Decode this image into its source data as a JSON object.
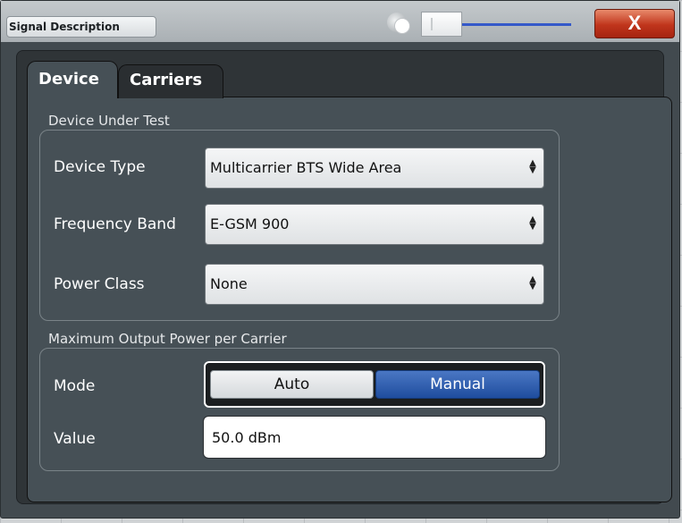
{
  "window": {
    "title": "Signal Description",
    "close_label": "X"
  },
  "tabs": [
    {
      "label": "Device",
      "active": true
    },
    {
      "label": "Carriers",
      "active": false
    }
  ],
  "device_under_test": {
    "group_title": "Device Under Test",
    "rows": [
      {
        "label": "Device Type",
        "value": "Multicarrier BTS Wide Area"
      },
      {
        "label": "Frequency Band",
        "value": "E-GSM 900"
      },
      {
        "label": "Power Class",
        "value": "None"
      }
    ]
  },
  "max_output_power": {
    "group_title": "Maximum Output Power per Carrier",
    "mode_label": "Mode",
    "mode_options": [
      "Auto",
      "Manual"
    ],
    "mode_selected": "Manual",
    "value_label": "Value",
    "value": "50.0 dBm"
  },
  "colors": {
    "dialog_bg": "#424a4f",
    "panel_bg": "#465056",
    "selected_accent": "#1f4d9e",
    "close_button": "#c0351c"
  },
  "icons": {
    "dropdown_arrow": "up-down-arrow-icon",
    "close": "close-icon"
  }
}
